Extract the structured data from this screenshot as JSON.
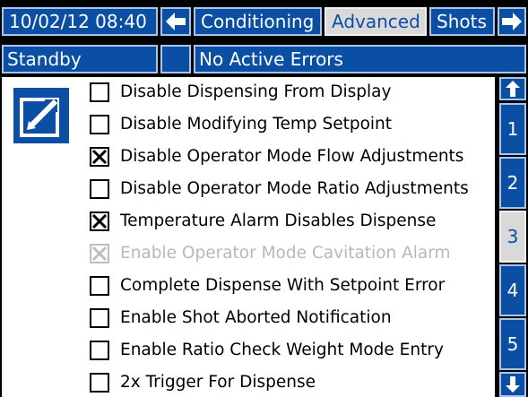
{
  "header": {
    "datetime": "10/02/12 08:40",
    "prev_icon": "left-arrow-icon",
    "next_icon": "right-arrow-icon",
    "tabs": [
      {
        "label": "Conditioning",
        "active": false
      },
      {
        "label": "Advanced",
        "active": true
      },
      {
        "label": "Shots",
        "active": false
      }
    ]
  },
  "status": {
    "mode": "Standby",
    "indicator": "",
    "errors": "No Active Errors"
  },
  "edit_icon": "edit-pencil-icon",
  "options": [
    {
      "label": "Disable Dispensing From Display",
      "checked": false,
      "disabled": false
    },
    {
      "label": "Disable Modifying Temp Setpoint",
      "checked": false,
      "disabled": false
    },
    {
      "label": "Disable Operator Mode Flow Adjustments",
      "checked": true,
      "disabled": false
    },
    {
      "label": "Disable Operator Mode Ratio Adjustments",
      "checked": false,
      "disabled": false
    },
    {
      "label": "Temperature Alarm Disables Dispense",
      "checked": true,
      "disabled": false
    },
    {
      "label": "Enable Operator Mode Cavitation Alarm",
      "checked": true,
      "disabled": true
    },
    {
      "label": "Complete Dispense With Setpoint Error",
      "checked": false,
      "disabled": false
    },
    {
      "label": "Enable Shot Aborted Notification",
      "checked": false,
      "disabled": false
    },
    {
      "label": "Enable Ratio Check Weight Mode Entry",
      "checked": false,
      "disabled": false
    },
    {
      "label": "2x Trigger For Dispense",
      "checked": false,
      "disabled": false
    }
  ],
  "pager": {
    "up_icon": "up-arrow-icon",
    "down_icon": "down-arrow-icon",
    "pages": [
      "1",
      "2",
      "3",
      "4",
      "5"
    ],
    "active_page": "3"
  },
  "colors": {
    "accent": "#0a4fa3",
    "active_tab": "#d9d9d9",
    "background": "#000000",
    "panel": "#ffffff"
  }
}
